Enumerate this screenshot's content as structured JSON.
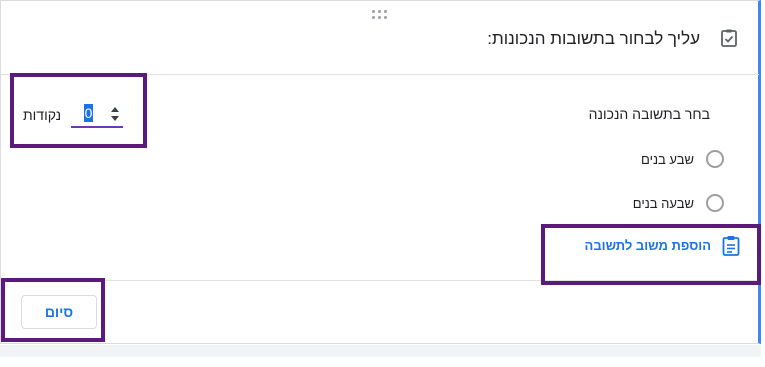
{
  "question": {
    "title": "עליך לבחור בתשובות הנכונות:",
    "icon": "clipboard-check-icon"
  },
  "points": {
    "value": "0",
    "label": "נקודות"
  },
  "answer_section": {
    "label": "בחר בתשובה הנכונה",
    "options": [
      {
        "label": "שבע בנים",
        "selected": false
      },
      {
        "label": "שבעה בנים",
        "selected": false
      }
    ]
  },
  "feedback_button": {
    "label": "הוספת משוב לתשובה",
    "icon": "feedback-clipboard-icon"
  },
  "done_button": {
    "label": "סיום"
  },
  "colors": {
    "accent": "#1a73e8",
    "card_border": "#4285f4",
    "highlight": "#5c1a7c",
    "input_underline": "#673ab7"
  }
}
